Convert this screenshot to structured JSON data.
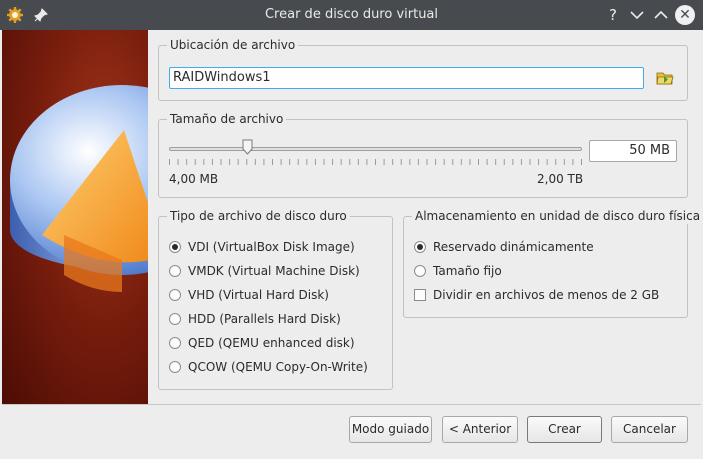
{
  "window": {
    "title": "Crear de disco duro virtual",
    "help_label": "?",
    "minimize_label": "∨",
    "maximize_label": "∧",
    "close_label": "✕"
  },
  "location": {
    "title": "Ubicación de archivo",
    "value": "RAIDWindows1"
  },
  "size": {
    "title": "Tamaño de archivo",
    "value": "50 MB",
    "min_label": "4,00 MB",
    "max_label": "2,00 TB",
    "slider_fraction": 0.19
  },
  "file_type": {
    "title": "Tipo de archivo de disco duro",
    "options": [
      {
        "label": "VDI (VirtualBox Disk Image)",
        "selected": true
      },
      {
        "label": "VMDK (Virtual Machine Disk)",
        "selected": false
      },
      {
        "label": "VHD (Virtual Hard Disk)",
        "selected": false
      },
      {
        "label": "HDD (Parallels Hard Disk)",
        "selected": false
      },
      {
        "label": "QED (QEMU enhanced disk)",
        "selected": false
      },
      {
        "label": "QCOW (QEMU Copy-On-Write)",
        "selected": false
      }
    ]
  },
  "storage": {
    "title": "Almacenamiento en unidad de disco duro física",
    "options": [
      {
        "label": "Reservado dinámicamente",
        "selected": true
      },
      {
        "label": "Tamaño fijo",
        "selected": false
      }
    ],
    "split_label": "Dividir en archivos de menos de 2 GB",
    "split_checked": false
  },
  "buttons": {
    "guided": "Modo guiado",
    "back": "< Anterior",
    "create": "Crear",
    "cancel": "Cancelar"
  },
  "colors": {
    "titlebar": "#474a4e",
    "focus": "#3daee9",
    "banner": "#7a1e0d"
  }
}
